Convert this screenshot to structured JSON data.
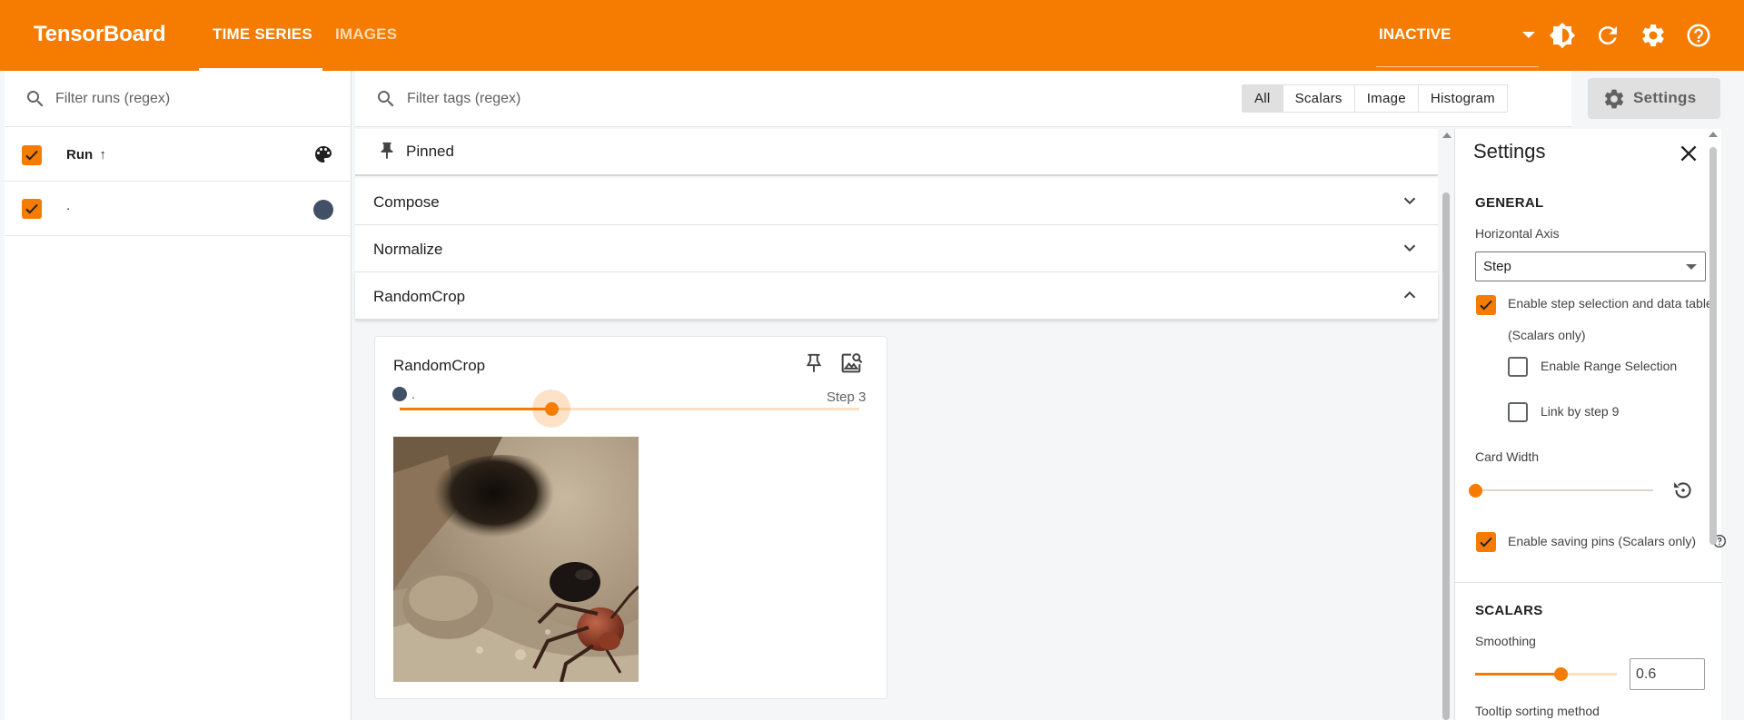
{
  "header": {
    "brand": "TensorBoard",
    "tabs": [
      {
        "label": "TIME SERIES",
        "active": true
      },
      {
        "label": "IMAGES",
        "active": false
      }
    ],
    "status": "INACTIVE",
    "icons": [
      "brightness-icon",
      "refresh-icon",
      "settings-gear-icon",
      "help-icon"
    ]
  },
  "runs": {
    "search_placeholder": "Filter runs (regex)",
    "header_label": "Run",
    "sort_glyph": "↑",
    "items": [
      {
        "label": ".",
        "checked": true,
        "color": "#425066"
      }
    ]
  },
  "main": {
    "search_placeholder": "Filter tags (regex)",
    "filters": [
      "All",
      "Scalars",
      "Image",
      "Histogram"
    ],
    "active_filter": "All",
    "settings_button": "Settings",
    "pinned_label": "Pinned",
    "groups": [
      {
        "name": "Compose",
        "expanded": false
      },
      {
        "name": "Normalize",
        "expanded": false
      },
      {
        "name": "RandomCrop",
        "expanded": true
      }
    ],
    "card": {
      "title": "RandomCrop",
      "run_label": ".",
      "step_label": "Step 3",
      "step_fraction": 0.33
    }
  },
  "settings": {
    "title": "Settings",
    "general_heading": "GENERAL",
    "horizontal_axis_label": "Horizontal Axis",
    "horizontal_axis_value": "Step",
    "step_selection_label": "Enable step selection and data table",
    "step_selection_sub": "(Scalars only)",
    "step_selection_checked": true,
    "range_selection_label": "Enable Range Selection",
    "range_selection_checked": false,
    "link_by_step_label": "Link by step 9",
    "link_by_step_checked": false,
    "card_width_label": "Card Width",
    "card_width_fraction": 0.0,
    "saving_pins_label": "Enable saving pins (Scalars only)",
    "saving_pins_checked": true,
    "scalars_heading": "SCALARS",
    "smoothing_label": "Smoothing",
    "smoothing_value": "0.6",
    "smoothing_fraction": 0.6,
    "tooltip_sort_label": "Tooltip sorting method"
  },
  "colors": {
    "accent": "#f57c00",
    "run_color": "#425066"
  }
}
